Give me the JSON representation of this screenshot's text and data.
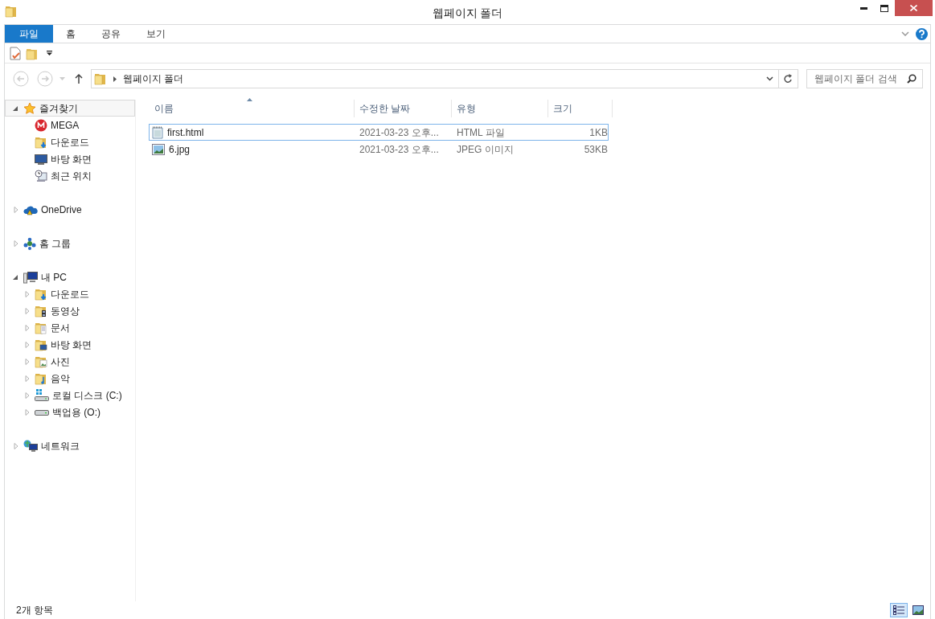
{
  "window": {
    "title": "웹페이지 폴더"
  },
  "ribbon": {
    "tabs": [
      {
        "label": "파일",
        "selected": true
      },
      {
        "label": "홈",
        "selected": false
      },
      {
        "label": "공유",
        "selected": false
      },
      {
        "label": "보기",
        "selected": false
      }
    ]
  },
  "address": {
    "path": "웹페이지 폴더"
  },
  "search": {
    "placeholder": "웹페이지 폴더 검색"
  },
  "navigation": [
    {
      "label": "즐겨찾기",
      "kind": "star",
      "expanded": true,
      "selected": true,
      "children": [
        {
          "label": "MEGA",
          "kind": "mega"
        },
        {
          "label": "다운로드",
          "kind": "folder-download"
        },
        {
          "label": "바탕 화면",
          "kind": "desktop"
        },
        {
          "label": "최근 위치",
          "kind": "recent"
        }
      ]
    },
    {
      "label": "OneDrive",
      "kind": "cloud",
      "expanded": false,
      "selected": false
    },
    {
      "label": "홈 그룹",
      "kind": "homegroup",
      "expanded": false,
      "selected": false
    },
    {
      "label": "내 PC",
      "kind": "pc",
      "expanded": true,
      "selected": false,
      "children": [
        {
          "label": "다운로드",
          "kind": "folder-download",
          "expanded": false
        },
        {
          "label": "동영상",
          "kind": "folder-video",
          "expanded": false
        },
        {
          "label": "문서",
          "kind": "folder-document",
          "expanded": false
        },
        {
          "label": "바탕 화면",
          "kind": "folder-desktop",
          "expanded": false
        },
        {
          "label": "사진",
          "kind": "folder-picture",
          "expanded": false
        },
        {
          "label": "음악",
          "kind": "folder-music",
          "expanded": false
        },
        {
          "label": "로컬 디스크 (C:)",
          "kind": "drive-system",
          "expanded": false
        },
        {
          "label": "백업용 (O:)",
          "kind": "drive",
          "expanded": false
        }
      ]
    },
    {
      "label": "네트워크",
      "kind": "network",
      "expanded": false,
      "selected": false
    }
  ],
  "table": {
    "columns": [
      "이름",
      "수정한 날짜",
      "유형",
      "크기"
    ],
    "rows": [
      {
        "kind": "html",
        "name": "first.html",
        "modified": "2021-03-23 오후...",
        "type": "HTML 파일",
        "size": "1KB",
        "selected": true
      },
      {
        "kind": "image",
        "name": "6.jpg",
        "modified": "2021-03-23 오후...",
        "type": "JPEG 이미지",
        "size": "53KB",
        "selected": false
      }
    ]
  },
  "status_bar": {
    "item_count": "2개 항목",
    "views": [
      {
        "kind": "details",
        "selected": true
      },
      {
        "kind": "large-icons",
        "selected": false
      }
    ]
  }
}
